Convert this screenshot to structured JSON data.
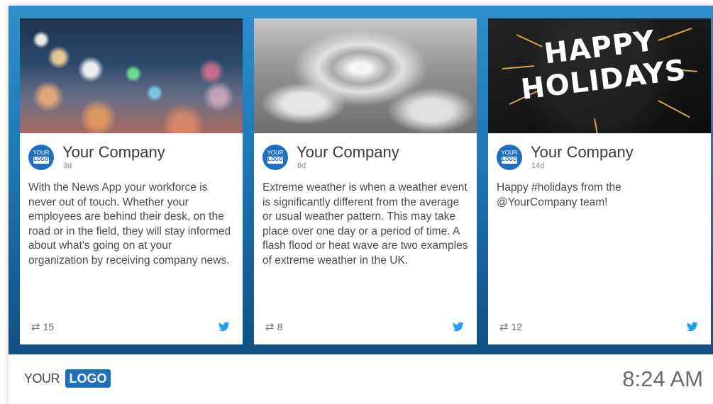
{
  "cards": [
    {
      "image_description": "",
      "author": "Your Company",
      "age": "3d",
      "avatar_top": "YOUR",
      "avatar_bottom": "LOGO",
      "text": "With the News App your workforce is never out of touch. Whether your employees are behind their desk, on the road or in the field, they will stay informed about what's going on at your organization by receiving company news.",
      "retweets": "15"
    },
    {
      "image_description": "",
      "author": "Your Company",
      "age": "8d",
      "avatar_top": "YOUR",
      "avatar_bottom": "LOGO",
      "text": "Extreme weather is when a weather event is significantly different from the average or usual weather pattern. This may take place over one day or a period of time. A flash flood or heat wave are two examples of extreme weather in the UK.",
      "retweets": "8"
    },
    {
      "image_text_line1": "HAPPY",
      "image_text_line2": "HOLIDAYS",
      "author": "Your Company",
      "age": "14d",
      "avatar_top": "YOUR",
      "avatar_bottom": "LOGO",
      "text": "Happy #holidays from the @YourCompany team!",
      "retweets": "12"
    }
  ],
  "footer": {
    "logo_your": "YOUR",
    "logo_box": "LOGO",
    "time": "8:24 AM"
  },
  "colors": {
    "wall_top": "#2f8fc9",
    "wall_bottom": "#124f84",
    "brand_blue": "#1f6fc0",
    "twitter_blue": "#1da1f2"
  },
  "icons": {
    "retweet": "retweet-icon",
    "twitter": "twitter-bird-icon"
  }
}
